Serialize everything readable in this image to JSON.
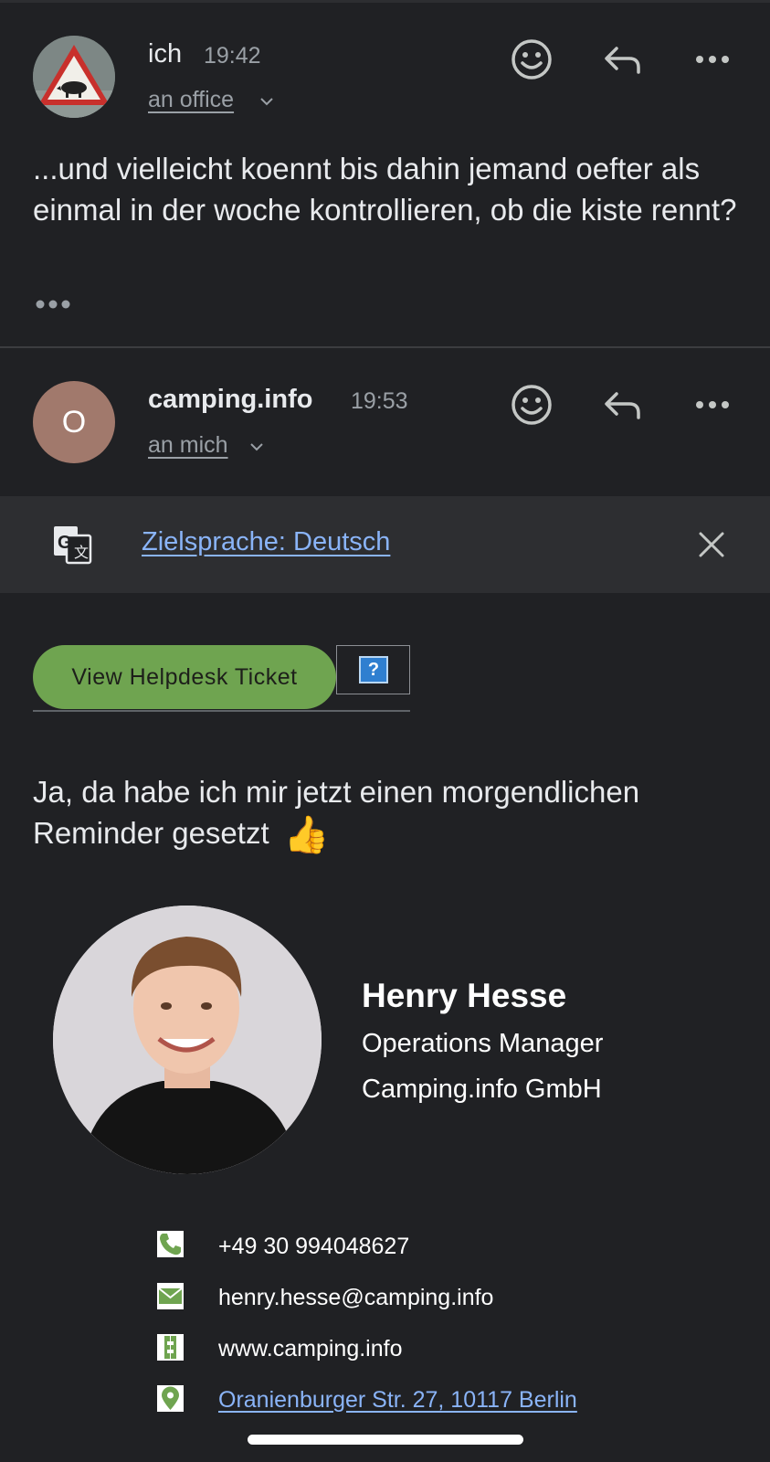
{
  "message1": {
    "sender": "ich",
    "time": "19:42",
    "recipient": "an office",
    "body": "...und vielleicht koennt bis dahin jemand oefter als einmal in der woche kontrollieren, ob die kiste rennt?"
  },
  "message2": {
    "avatar_letter": "O",
    "sender": "camping.info",
    "time": "19:53",
    "recipient": "an mich",
    "translate_label": "Zielsprache: Deutsch",
    "helpdesk_button": "View Helpdesk Ticket",
    "helpdesk_help_glyph": "?",
    "body": "Ja, da habe ich mir jetzt einen morgendlichen Reminder gesetzt",
    "emoji": "👍",
    "signature": {
      "name": "Henry Hesse",
      "title": "Operations Manager",
      "company": "Camping.info GmbH",
      "phone": "+49 30 994048627",
      "email": "henry.hesse@camping.info",
      "website": "www.camping.info",
      "address": "Oranienburger Str. 27, 10117 Berlin"
    }
  },
  "colors": {
    "background": "#202124",
    "link": "#8ab4f8",
    "helpdesk_green": "#6fa450",
    "avatar_brown": "#a1796c"
  },
  "icons": [
    "emoji-reaction-icon",
    "reply-icon",
    "more-options-icon",
    "translate-icon",
    "close-icon",
    "phone-icon",
    "email-icon",
    "web-icon",
    "location-icon"
  ]
}
